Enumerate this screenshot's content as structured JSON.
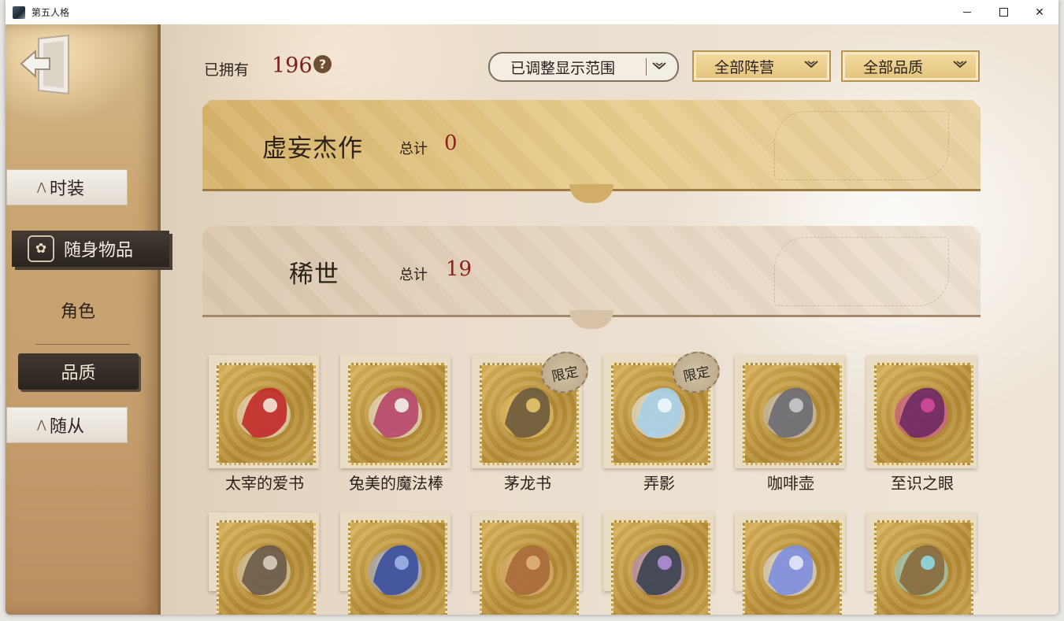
{
  "window": {
    "title": "第五人格"
  },
  "sidebar": {
    "items": [
      {
        "label": "时装"
      },
      {
        "label": "随身物品"
      },
      {
        "label": "角色"
      },
      {
        "label": "品质"
      },
      {
        "label": "随从"
      }
    ]
  },
  "topbar": {
    "owned_label": "已拥有",
    "owned_count": "196",
    "help_glyph": "?",
    "range_dropdown": "已调整显示范围",
    "camp_dropdown": "全部阵营",
    "quality_dropdown": "全部品质"
  },
  "banners": [
    {
      "title": "虚妄杰作",
      "total_label": "总计",
      "total": "0"
    },
    {
      "title": "稀世",
      "total_label": "总计",
      "total": "19"
    }
  ],
  "items_row1": [
    {
      "name": "太宰的爱书",
      "icon": "red-book-icon",
      "tag": ""
    },
    {
      "name": "兔美的魔法棒",
      "icon": "magic-wand-icon",
      "tag": ""
    },
    {
      "name": "茅龙书",
      "icon": "dragon-book-icon",
      "tag": "限定"
    },
    {
      "name": "弄影",
      "icon": "shadow-vase-icon",
      "tag": "限定"
    },
    {
      "name": "咖啡壶",
      "icon": "coffee-pot-icon",
      "tag": ""
    },
    {
      "name": "至识之眼",
      "icon": "eye-orb-icon",
      "tag": ""
    }
  ],
  "items_row2": [
    {
      "icon": "creature-icon"
    },
    {
      "icon": "blue-potion-icon"
    },
    {
      "icon": "scroll-icon"
    },
    {
      "icon": "gauntlet-icon"
    },
    {
      "icon": "crystal-icon"
    },
    {
      "icon": "butterfly-icon"
    }
  ],
  "colors": {
    "accent_red": "#8a2020",
    "nav_active_bg": "#2a241f",
    "gold": "#d8b46c"
  }
}
